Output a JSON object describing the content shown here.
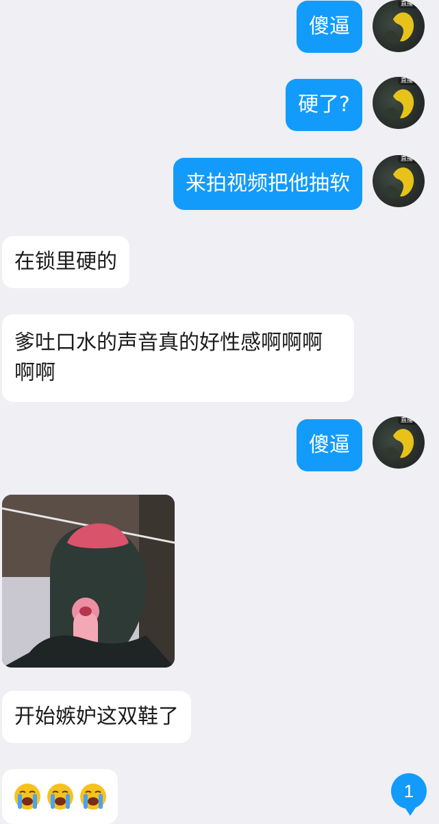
{
  "avatar": {
    "tag": "直播中"
  },
  "messages": {
    "m1": "傻逼",
    "m2": "硬了?",
    "m3": "来拍视频把他抽软",
    "m4": "在锁里硬的",
    "m5": "爹吐口水的声音真的好性感啊啊啊啊啊",
    "m6": "傻逼",
    "m8": "开始嫉妒这双鞋了"
  },
  "emoji_message": {
    "icons": [
      "loudly-crying-face-icon",
      "loudly-crying-face-icon",
      "loudly-crying-face-icon"
    ]
  },
  "unread": {
    "count": "1"
  },
  "colors": {
    "sent_bubble": "#129bfb",
    "received_bubble": "#ffffff",
    "background": "#efeff4"
  }
}
